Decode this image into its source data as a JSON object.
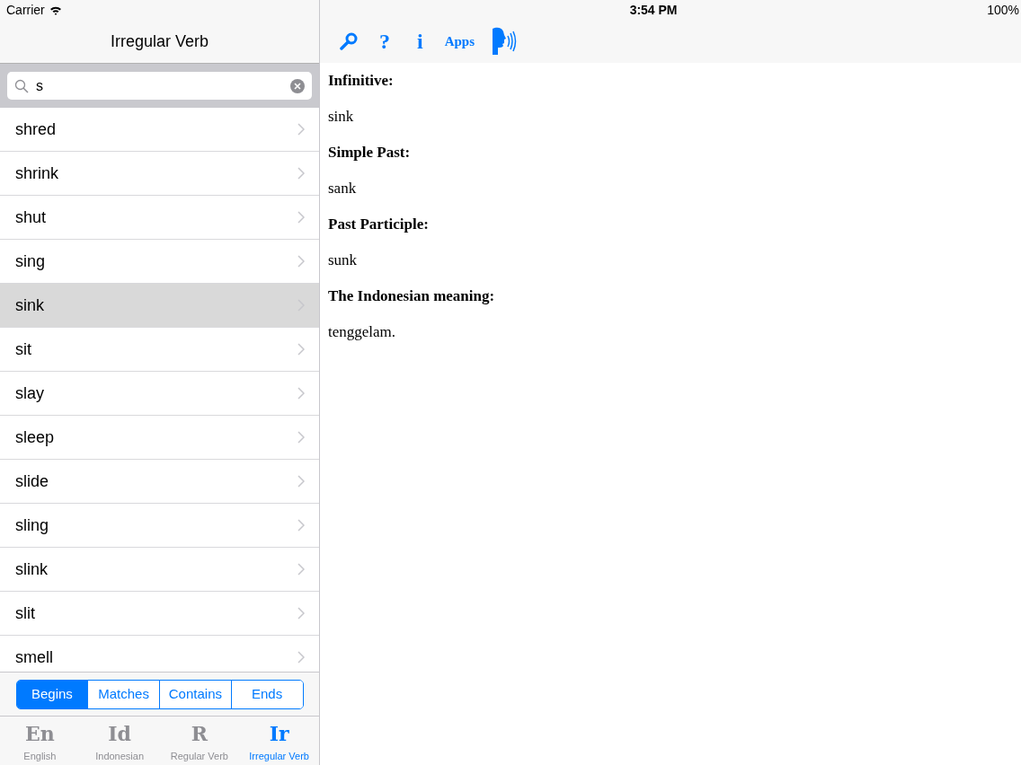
{
  "status_bar": {
    "carrier": "Carrier",
    "time": "3:54 PM",
    "battery": "100%"
  },
  "sidebar": {
    "title": "Irregular Verb",
    "search": {
      "value": "s"
    },
    "items": [
      {
        "label": "shred",
        "selected": false
      },
      {
        "label": "shrink",
        "selected": false
      },
      {
        "label": "shut",
        "selected": false
      },
      {
        "label": "sing",
        "selected": false
      },
      {
        "label": "sink",
        "selected": true
      },
      {
        "label": "sit",
        "selected": false
      },
      {
        "label": "slay",
        "selected": false
      },
      {
        "label": "sleep",
        "selected": false
      },
      {
        "label": "slide",
        "selected": false
      },
      {
        "label": "sling",
        "selected": false
      },
      {
        "label": "slink",
        "selected": false
      },
      {
        "label": "slit",
        "selected": false
      },
      {
        "label": "smell",
        "selected": false
      }
    ],
    "match_modes": [
      {
        "label": "Begins",
        "selected": true
      },
      {
        "label": "Matches",
        "selected": false
      },
      {
        "label": "Contains",
        "selected": false
      },
      {
        "label": "Ends",
        "selected": false
      }
    ],
    "tabs": [
      {
        "glyph": "En",
        "label": "English",
        "selected": false
      },
      {
        "glyph": "Id",
        "label": "Indonesian",
        "selected": false
      },
      {
        "glyph": "R",
        "label": "Regular Verb",
        "selected": false
      },
      {
        "glyph": "Ir",
        "label": "Irregular Verb",
        "selected": true
      }
    ]
  },
  "toolbar": [
    {
      "kind": "search"
    },
    {
      "kind": "text",
      "label": "?"
    },
    {
      "kind": "text",
      "label": "i"
    },
    {
      "kind": "small_text",
      "label": "Apps"
    },
    {
      "kind": "speak"
    }
  ],
  "detail": [
    {
      "heading": "Infinitive:",
      "value": "sink"
    },
    {
      "heading": "Simple Past:",
      "value": "sank"
    },
    {
      "heading": "Past Participle:",
      "value": "sunk"
    },
    {
      "heading": "The Indonesian meaning:",
      "value": "tenggelam."
    }
  ]
}
